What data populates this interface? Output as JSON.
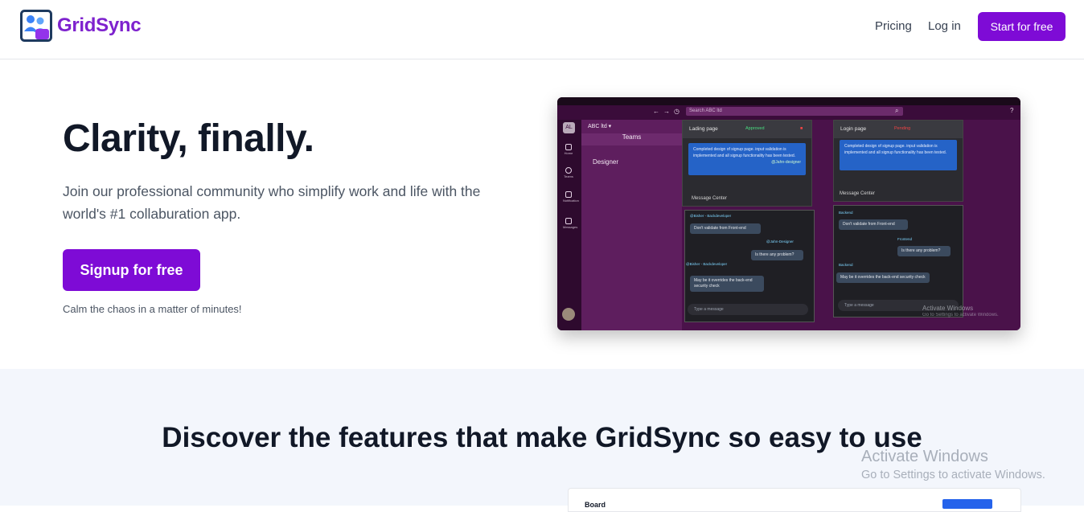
{
  "nav": {
    "brand": "GridSync",
    "links": [
      "Pricing",
      "Log in"
    ],
    "cta": "Start for free"
  },
  "hero": {
    "title": "Clarity, finally.",
    "subtitle": "Join our professional community who simplify work and life with the world's #1 collaburation app.",
    "button": "Signup for free",
    "note": "Calm the chaos in a matter of minutes!"
  },
  "preview": {
    "search_placeholder": "Search ABC ltd",
    "avatar": "AL",
    "org": "ABC ltd",
    "teams": "Teams",
    "team_item": "Designer",
    "rail": [
      "Home",
      "Teams",
      "Notification",
      "Messages"
    ],
    "card1": {
      "title": "Lading page",
      "status": "Approved",
      "description": "Completed design of signup page. input validation is implemented and all signup functionality has been tested.",
      "tag": "@Jahn-designer",
      "message_center": "Message Center"
    },
    "card2": {
      "title": "Login page",
      "status": "Pending",
      "description": "Completed design of signup page. input validation is implemented and all signup functionality has been tested.",
      "message_center": "Message Center"
    },
    "chat1": {
      "msg1_who": "@Bisher - Backdeveloper",
      "msg1": "Don't validate from Front-end",
      "msg2_who": "@Jahn-Designer",
      "msg2": "Is there any problem?",
      "msg3_who": "@Bisher - Backdeveloper",
      "msg3": "May be it overrides the back-end security check",
      "input": "Type a message"
    },
    "chat2": {
      "msg1_who": "Backend",
      "msg1": "Don't validate from Front-end",
      "msg2_who": "Frontend",
      "msg2": "Is there any problem?",
      "msg3_who": "Backend",
      "msg3": "May be it overrides the back-end security check",
      "input": "Type a message"
    },
    "watermark": "Activate Windows",
    "watermark_sub": "Go to Settings to activate Windows."
  },
  "features": {
    "title": "Discover the features that make GridSync so easy to use",
    "board_title": "Board"
  },
  "windows_watermark": {
    "line1": "Activate Windows",
    "line2": "Go to Settings to activate Windows."
  },
  "colors": {
    "brand": "#7e22ce",
    "button": "#7e0bd6",
    "features_bg": "#f3f6fc",
    "preview_bg": "#3f0f3f"
  }
}
